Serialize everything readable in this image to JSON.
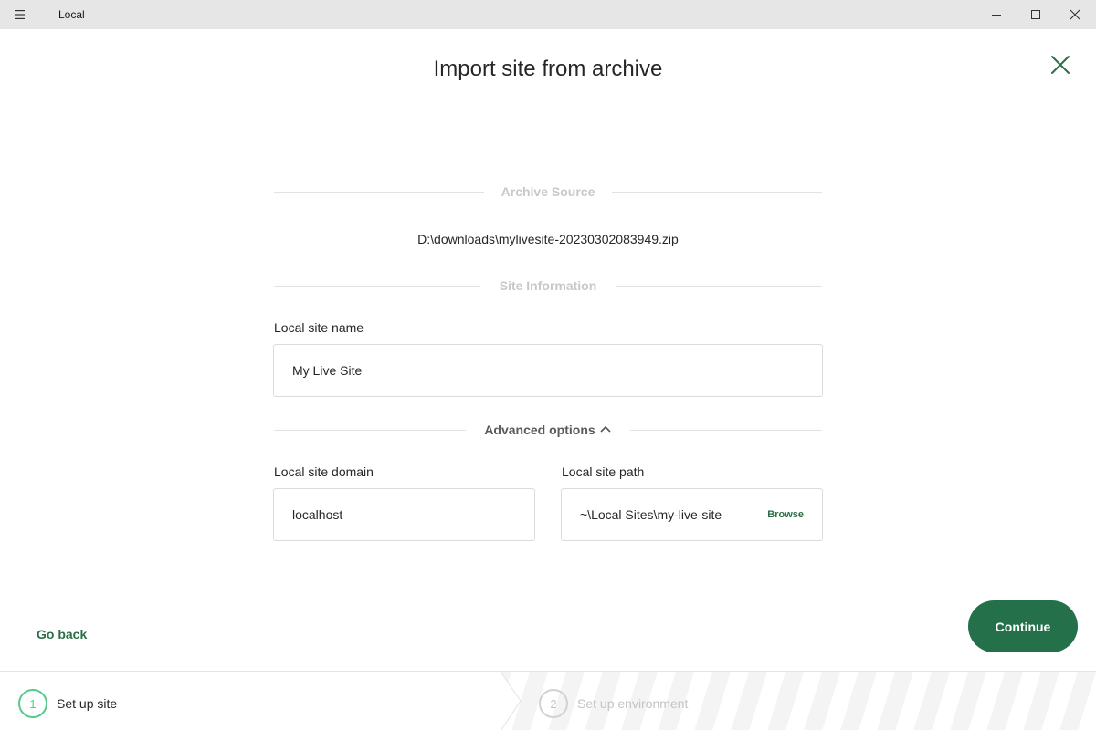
{
  "window": {
    "app_title": "Local",
    "menu_icon": "hamburger-icon",
    "minimize_icon": "minimize-icon",
    "maximize_icon": "maximize-icon",
    "close_icon": "close-icon"
  },
  "header": {
    "title": "Import site from archive",
    "close_icon": "close-x-icon"
  },
  "archive_source": {
    "section_label": "Archive Source",
    "path": "D:\\downloads\\mylivesite-20230302083949.zip"
  },
  "site_information": {
    "section_label": "Site Information",
    "site_name_label": "Local site name",
    "site_name_value": "My Live Site"
  },
  "advanced": {
    "toggle_label": "Advanced options",
    "toggle_icon": "chevron-up-icon",
    "domain_label": "Local site domain",
    "domain_value": "localhost",
    "path_label": "Local site path",
    "path_value": "~\\Local Sites\\my-live-site",
    "browse_label": "Browse"
  },
  "footer": {
    "go_back_label": "Go back",
    "continue_label": "Continue"
  },
  "steps": [
    {
      "number": "1",
      "label": "Set up site",
      "state": "active"
    },
    {
      "number": "2",
      "label": "Set up environment",
      "state": "inactive"
    }
  ],
  "colors": {
    "accent": "#23704a",
    "link": "#2a6f46",
    "step_active": "#59c98a",
    "muted": "#c4c4c4"
  }
}
